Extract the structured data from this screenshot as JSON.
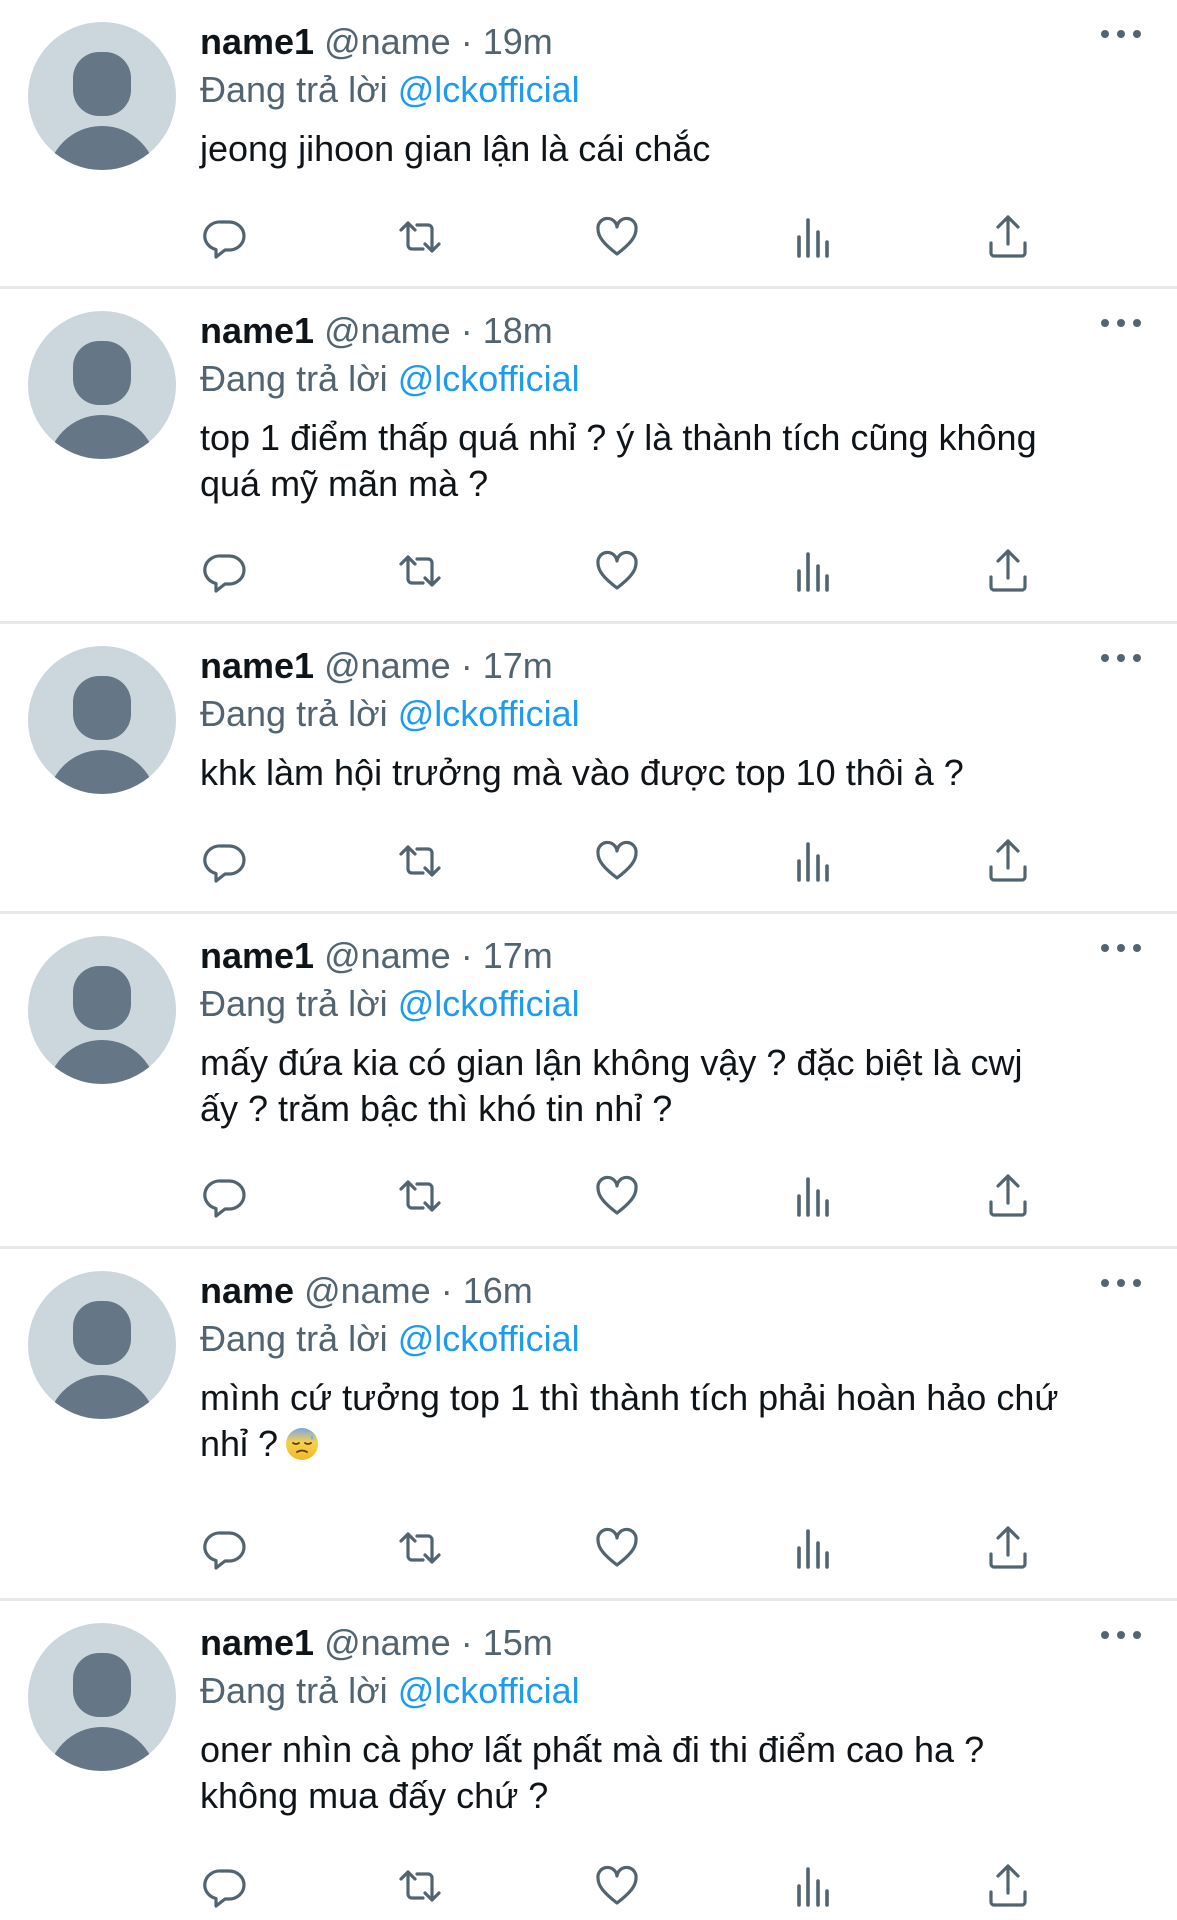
{
  "tweets": [
    {
      "name": "name1",
      "handle": "@name",
      "time": "19m",
      "reply_prefix": "Đang trả lời",
      "reply_to": "@lckofficial",
      "text": "jeong jihoon gian lận là cái chắc"
    },
    {
      "name": "name1",
      "handle": "@name",
      "time": "18m",
      "reply_prefix": "Đang trả lời",
      "reply_to": "@lckofficial",
      "text": "top 1 điểm thấp quá nhỉ ? ý là thành tích cũng không\nquá mỹ mãn mà ?"
    },
    {
      "name": "name1",
      "handle": "@name",
      "time": "17m",
      "reply_prefix": "Đang trả lời",
      "reply_to": "@lckofficial",
      "text": "khk làm hội trưởng mà vào được top 10 thôi à ?"
    },
    {
      "name": "name1",
      "handle": "@name",
      "time": "17m",
      "reply_prefix": "Đang trả lời",
      "reply_to": "@lckofficial",
      "text": "mấy đứa kia có gian lận không vậy ? đặc biệt là cwj\nấy ? trăm bậc thì khó tin nhỉ ?"
    },
    {
      "name": "name",
      "handle": "@name",
      "time": "16m",
      "reply_prefix": "Đang trả lời",
      "reply_to": "@lckofficial",
      "text": "mình cứ tưởng top 1 thì thành tích phải hoàn hảo chứ\nnhỉ ?",
      "emoji": "downcast-face-with-sweat-icon"
    },
    {
      "name": "name1",
      "handle": "@name",
      "time": "15m",
      "reply_prefix": "Đang trả lời",
      "reply_to": "@lckofficial",
      "text": "oner nhìn cà phơ lất phất mà đi thi điểm cao ha ?\nkhông mua đấy chứ ?"
    }
  ],
  "separator": "·",
  "action_icons": [
    "reply-icon",
    "retweet-icon",
    "like-icon",
    "analytics-icon",
    "share-icon"
  ],
  "colors": {
    "text": "#0f1419",
    "secondary": "#536471",
    "mention": "#1d9bf0",
    "avatar_bg": "#ccd6dd",
    "avatar_fg": "#657786",
    "divider": "#e6e9eb"
  }
}
